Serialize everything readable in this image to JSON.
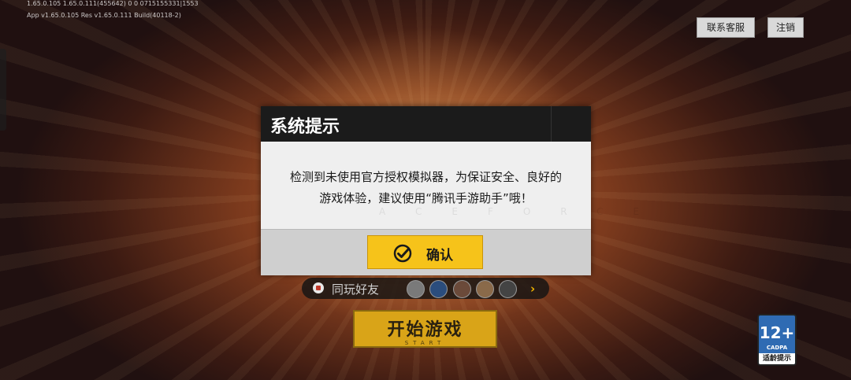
{
  "version": {
    "line1": "1.65.0.105  1.65.0.111(455642)  0  0    0715155331|1553",
    "line2": "App  v1.65.0.105    Res  v1.65.0.111    Build(40118-2)"
  },
  "header": {
    "support_label": "联系客服",
    "logout_label": "注销"
  },
  "dialog": {
    "title": "系统提示",
    "message_line1": "检测到未使用官方授权模拟器，为保证安全、良好的",
    "message_line2": "游戏体验，建议使用“腾讯手游助手”哦！",
    "watermark": "ACEFORCE",
    "confirm_label": "确认"
  },
  "friends": {
    "label": "同玩好友",
    "arrow": "›"
  },
  "start": {
    "label": "开始游戏",
    "sub_label": "START"
  },
  "age_rating": {
    "rating": "12+",
    "org": "CADPA",
    "tip": "适龄提示"
  },
  "colors": {
    "accent": "#f6c31a",
    "start_button": "#d9a418",
    "dialog_header": "#1b1b1b"
  }
}
